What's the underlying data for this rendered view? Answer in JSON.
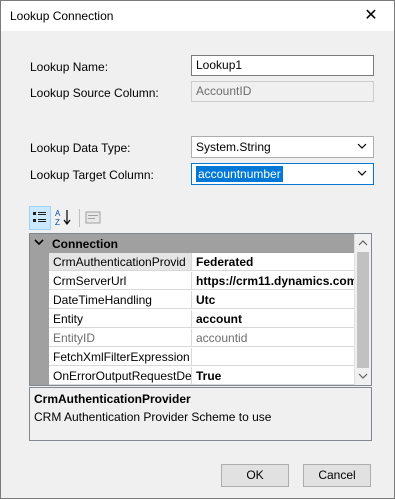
{
  "window": {
    "title": "Lookup Connection"
  },
  "form": {
    "lookup_name_label": "Lookup Name:",
    "lookup_name_value": "Lookup1",
    "lookup_source_label": "Lookup Source Column:",
    "lookup_source_value": "AccountID",
    "lookup_type_label": "Lookup Data Type:",
    "lookup_type_value": "System.String",
    "lookup_target_label": "Lookup Target Column:",
    "lookup_target_value": "accountnumber"
  },
  "grid": {
    "category": "Connection",
    "rows": [
      {
        "name": "CrmAuthenticationProvid",
        "value": "Federated"
      },
      {
        "name": "CrmServerUrl",
        "value": "https://crm11.dynamics.com"
      },
      {
        "name": "DateTimeHandling",
        "value": "Utc"
      },
      {
        "name": "Entity",
        "value": "account"
      },
      {
        "name": "EntityID",
        "value": "accountid"
      },
      {
        "name": "FetchXmlFilterExpression",
        "value": ""
      },
      {
        "name": "OnErrorOutputRequestDe",
        "value": "True"
      }
    ]
  },
  "description": {
    "title": "CrmAuthenticationProvider",
    "text": "CRM Authentication Provider Scheme to use"
  },
  "buttons": {
    "ok": "OK",
    "cancel": "Cancel"
  },
  "icons": [
    "close-icon",
    "categorized-icon",
    "alphabetical-sort-icon",
    "property-pages-icon",
    "chevron-down-icon",
    "collapse-icon",
    "scroll-up-icon",
    "scroll-down-icon"
  ],
  "colors": {
    "accent": "#0078d7",
    "category_bg": "#a0a0a0",
    "window_bg": "#f0f0f0"
  }
}
